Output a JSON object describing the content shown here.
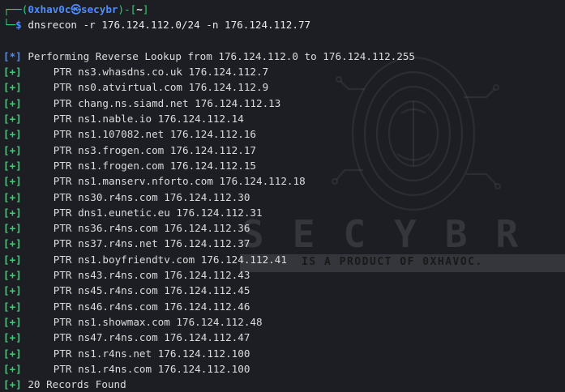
{
  "prompt": {
    "open": "┌──(",
    "user_host": "0xhav0c㉿secybr",
    "mid": ")-[",
    "cwd": "~",
    "close": "]",
    "second_prefix": "└─",
    "dollar": "$",
    "command": "dnsrecon -r 176.124.112.0/24 -n 176.124.112.77"
  },
  "info": {
    "tag": "[*]",
    "text": "Performing Reverse Lookup from 176.124.112.0 to 176.124.112.255"
  },
  "records": [
    {
      "tag": "[+]",
      "type": "PTR",
      "host": "ns3.whasdns.co.uk",
      "ip": "176.124.112.7"
    },
    {
      "tag": "[+]",
      "type": "PTR",
      "host": "ns0.atvirtual.com",
      "ip": "176.124.112.9"
    },
    {
      "tag": "[+]",
      "type": "PTR",
      "host": "chang.ns.siamd.net",
      "ip": "176.124.112.13"
    },
    {
      "tag": "[+]",
      "type": "PTR",
      "host": "ns1.nable.io",
      "ip": "176.124.112.14"
    },
    {
      "tag": "[+]",
      "type": "PTR",
      "host": "ns1.107082.net",
      "ip": "176.124.112.16"
    },
    {
      "tag": "[+]",
      "type": "PTR",
      "host": "ns3.frogen.com",
      "ip": "176.124.112.17"
    },
    {
      "tag": "[+]",
      "type": "PTR",
      "host": "ns1.frogen.com",
      "ip": "176.124.112.15"
    },
    {
      "tag": "[+]",
      "type": "PTR",
      "host": "ns1.manserv.nforto.com",
      "ip": "176.124.112.18"
    },
    {
      "tag": "[+]",
      "type": "PTR",
      "host": "ns30.r4ns.com",
      "ip": "176.124.112.30"
    },
    {
      "tag": "[+]",
      "type": "PTR",
      "host": "dns1.eunetic.eu",
      "ip": "176.124.112.31"
    },
    {
      "tag": "[+]",
      "type": "PTR",
      "host": "ns36.r4ns.com",
      "ip": "176.124.112.36"
    },
    {
      "tag": "[+]",
      "type": "PTR",
      "host": "ns37.r4ns.net",
      "ip": "176.124.112.37"
    },
    {
      "tag": "[+]",
      "type": "PTR",
      "host": "ns1.boyfriendtv.com",
      "ip": "176.124.112.41"
    },
    {
      "tag": "[+]",
      "type": "PTR",
      "host": "ns43.r4ns.com",
      "ip": "176.124.112.43"
    },
    {
      "tag": "[+]",
      "type": "PTR",
      "host": "ns45.r4ns.com",
      "ip": "176.124.112.45"
    },
    {
      "tag": "[+]",
      "type": "PTR",
      "host": "ns46.r4ns.com",
      "ip": "176.124.112.46"
    },
    {
      "tag": "[+]",
      "type": "PTR",
      "host": "ns1.showmax.com",
      "ip": "176.124.112.48"
    },
    {
      "tag": "[+]",
      "type": "PTR",
      "host": "ns47.r4ns.com",
      "ip": "176.124.112.47"
    },
    {
      "tag": "[+]",
      "type": "PTR",
      "host": "ns1.r4ns.net",
      "ip": "176.124.112.100"
    },
    {
      "tag": "[+]",
      "type": "PTR",
      "host": "ns1.r4ns.com",
      "ip": "176.124.112.100"
    }
  ],
  "summary": {
    "tag": "[+]",
    "text": "20 Records Found"
  },
  "watermark": {
    "text": "SECYBR",
    "banner": "IS A PRODUCT OF 0XHAVOC."
  },
  "colors": {
    "background": "#1c1e24",
    "prompt_blue": "#4f8cff",
    "success_green": "#37d26b",
    "text": "#dcdcdc"
  }
}
